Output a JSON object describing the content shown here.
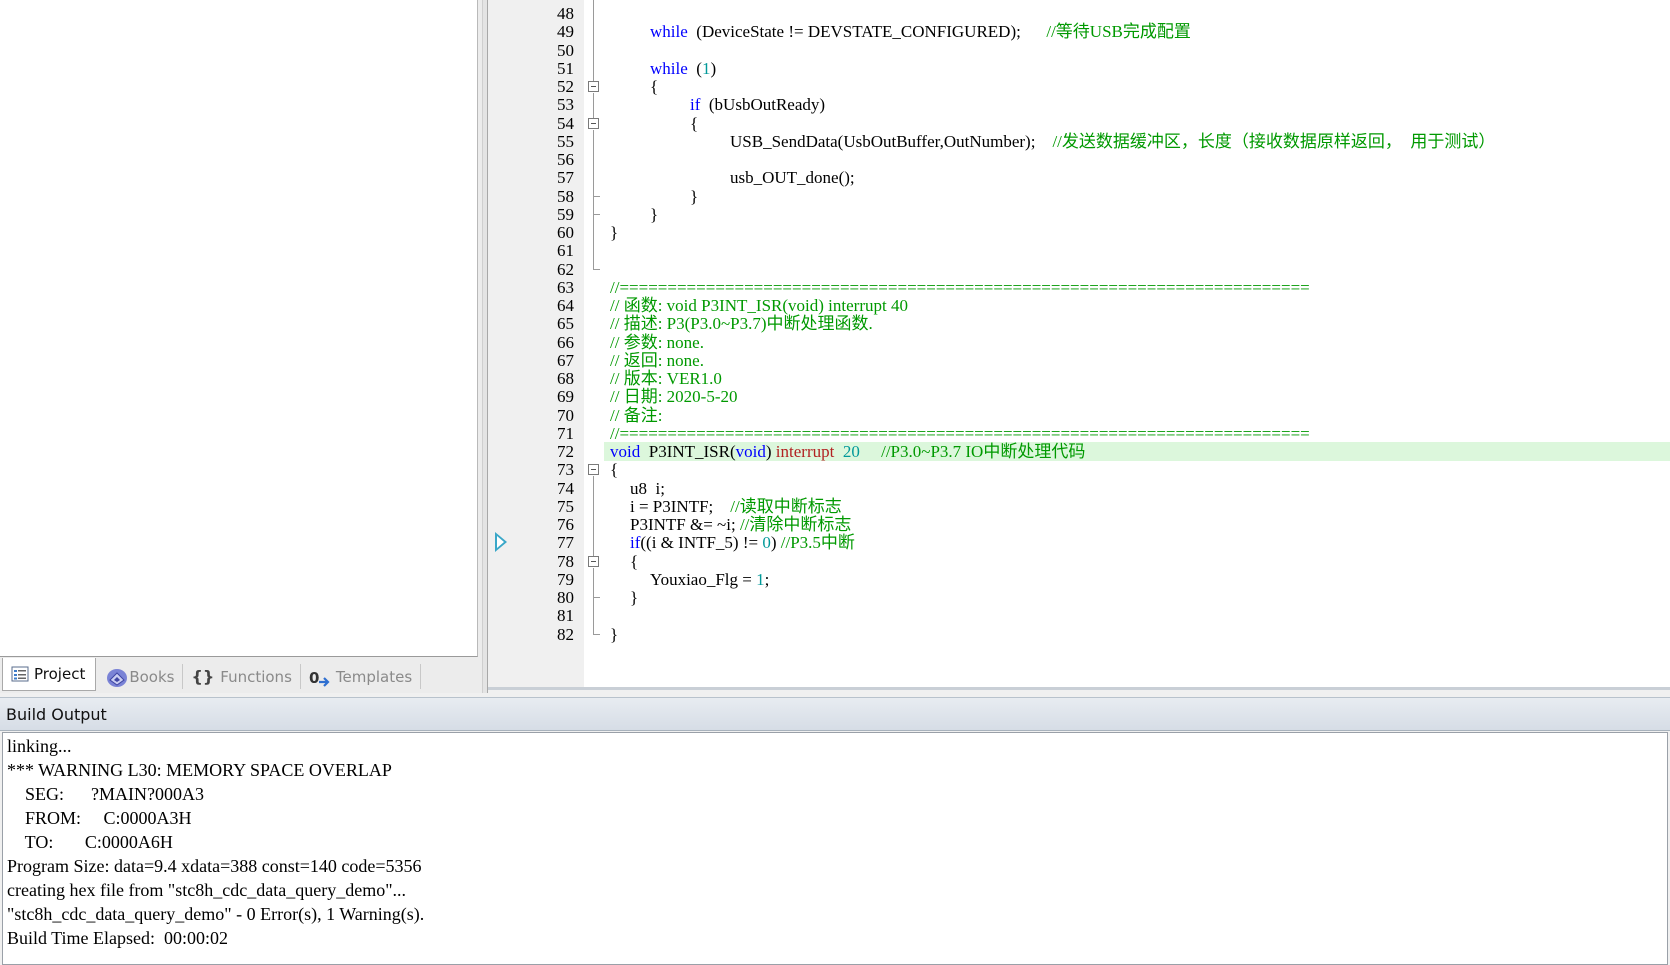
{
  "project_panel": {
    "tabs": [
      {
        "label": "Project",
        "icon": "project-icon",
        "active": true
      },
      {
        "label": "Books",
        "icon": "books-icon",
        "active": false
      },
      {
        "label": "Functions",
        "icon": "braces-icon",
        "active": false
      },
      {
        "label": "Templates",
        "icon": "templates-icon",
        "active": false
      }
    ]
  },
  "editor": {
    "current_line": 72,
    "execution_line": 77,
    "lines": [
      {
        "n": "48",
        "code": "",
        "indent": 0
      },
      {
        "n": "49",
        "indent": 40,
        "tokens": [
          [
            "kw",
            "while"
          ],
          [
            "",
            "  (DeviceState != DEVSTATE_CONFIGURED);      "
          ],
          [
            "cm",
            "//等待USB完成配置"
          ]
        ]
      },
      {
        "n": "50",
        "code": "",
        "indent": 0
      },
      {
        "n": "51",
        "indent": 40,
        "tokens": [
          [
            "kw",
            "while"
          ],
          [
            "",
            "  ("
          ],
          [
            "num",
            "1"
          ],
          [
            "",
            ")"
          ]
        ]
      },
      {
        "n": "52",
        "indent": 40,
        "tokens": [
          [
            "",
            "{"
          ]
        ]
      },
      {
        "n": "53",
        "indent": 80,
        "tokens": [
          [
            "kw",
            "if"
          ],
          [
            "",
            "  (bUsbOutReady)"
          ]
        ]
      },
      {
        "n": "54",
        "indent": 80,
        "tokens": [
          [
            "",
            "{"
          ]
        ]
      },
      {
        "n": "55",
        "indent": 120,
        "tokens": [
          [
            "",
            "USB_SendData(UsbOutBuffer,OutNumber);    "
          ],
          [
            "cm",
            "//发送数据缓冲区，长度（接收数据原样返回，  用于测试）"
          ]
        ]
      },
      {
        "n": "56",
        "code": "",
        "indent": 0
      },
      {
        "n": "57",
        "indent": 120,
        "tokens": [
          [
            "",
            "usb_OUT_done();"
          ]
        ]
      },
      {
        "n": "58",
        "indent": 80,
        "tokens": [
          [
            "",
            "}"
          ]
        ]
      },
      {
        "n": "59",
        "indent": 40,
        "tokens": [
          [
            "",
            "}"
          ]
        ]
      },
      {
        "n": "60",
        "indent": 0,
        "tokens": [
          [
            "",
            "}"
          ]
        ]
      },
      {
        "n": "61",
        "code": "",
        "indent": 0
      },
      {
        "n": "62",
        "code": "",
        "indent": 0
      },
      {
        "n": "63",
        "indent": 0,
        "tokens": [
          [
            "cm",
            "//========================================================================"
          ]
        ]
      },
      {
        "n": "64",
        "indent": 0,
        "tokens": [
          [
            "cm",
            "// 函数: void P3INT_ISR(void) interrupt 40"
          ]
        ]
      },
      {
        "n": "65",
        "indent": 0,
        "tokens": [
          [
            "cm",
            "// 描述: P3(P3.0~P3.7)中断处理函数."
          ]
        ]
      },
      {
        "n": "66",
        "indent": 0,
        "tokens": [
          [
            "cm",
            "// 参数: none."
          ]
        ]
      },
      {
        "n": "67",
        "indent": 0,
        "tokens": [
          [
            "cm",
            "// 返回: none."
          ]
        ]
      },
      {
        "n": "68",
        "indent": 0,
        "tokens": [
          [
            "cm",
            "// 版本: VER1.0"
          ]
        ]
      },
      {
        "n": "69",
        "indent": 0,
        "tokens": [
          [
            "cm",
            "// 日期: 2020-5-20"
          ]
        ]
      },
      {
        "n": "70",
        "indent": 0,
        "tokens": [
          [
            "cm",
            "// 备注:"
          ]
        ]
      },
      {
        "n": "71",
        "indent": 0,
        "tokens": [
          [
            "cm",
            "//========================================================================"
          ]
        ]
      },
      {
        "n": "72",
        "indent": 0,
        "tokens": [
          [
            "kw",
            "void"
          ],
          [
            "",
            "  P3INT_ISR("
          ],
          [
            "kw",
            "void"
          ],
          [
            "",
            ") "
          ],
          [
            "intr",
            "interrupt"
          ],
          [
            "",
            "  "
          ],
          [
            "num",
            "20"
          ],
          [
            "",
            "     "
          ],
          [
            "cm",
            "//P3.0~P3.7 IO中断处理代码"
          ]
        ]
      },
      {
        "n": "73",
        "indent": 0,
        "tokens": [
          [
            "",
            "{"
          ]
        ]
      },
      {
        "n": "74",
        "indent": 20,
        "tokens": [
          [
            "",
            "u8  i;"
          ]
        ]
      },
      {
        "n": "75",
        "indent": 20,
        "tokens": [
          [
            "",
            "i = P3INTF;    "
          ],
          [
            "cm",
            "//读取中断标志"
          ]
        ]
      },
      {
        "n": "76",
        "indent": 20,
        "tokens": [
          [
            "",
            "P3INTF &= ~i; "
          ],
          [
            "cm",
            "//清除中断标志"
          ]
        ]
      },
      {
        "n": "77",
        "indent": 20,
        "tokens": [
          [
            "kw",
            "if"
          ],
          [
            "",
            "((i & INTF_5) != "
          ],
          [
            "num",
            "0"
          ],
          [
            "",
            ") "
          ],
          [
            "cm",
            "//P3.5中断"
          ]
        ]
      },
      {
        "n": "78",
        "indent": 20,
        "tokens": [
          [
            "",
            "{"
          ]
        ]
      },
      {
        "n": "79",
        "indent": 40,
        "tokens": [
          [
            "",
            "Youxiao_Flg = "
          ],
          [
            "num",
            "1"
          ],
          [
            "",
            ";"
          ]
        ]
      },
      {
        "n": "80",
        "indent": 20,
        "tokens": [
          [
            "",
            "}"
          ]
        ]
      },
      {
        "n": "81",
        "code": "",
        "indent": 0
      },
      {
        "n": "82",
        "indent": 0,
        "tokens": [
          [
            "",
            "}"
          ]
        ]
      }
    ]
  },
  "build_output": {
    "title": "Build Output",
    "lines": [
      "linking...",
      "*** WARNING L30: MEMORY SPACE OVERLAP",
      "    SEG:      ?MAIN?000A3",
      "    FROM:     C:0000A3H",
      "    TO:       C:0000A6H",
      "Program Size: data=9.4 xdata=388 const=140 code=5356",
      "creating hex file from \"stc8h_cdc_data_query_demo\"...",
      "\"stc8h_cdc_data_query_demo\" - 0 Error(s), 1 Warning(s).",
      "Build Time Elapsed:  00:00:02"
    ]
  },
  "colors": {
    "keyword": "#0000ff",
    "comment": "#009900",
    "number": "#009999",
    "interrupt_keyword": "#b22222",
    "current_line_highlight": "#dcf7dc",
    "execution_arrow": "#3aa7c8"
  }
}
